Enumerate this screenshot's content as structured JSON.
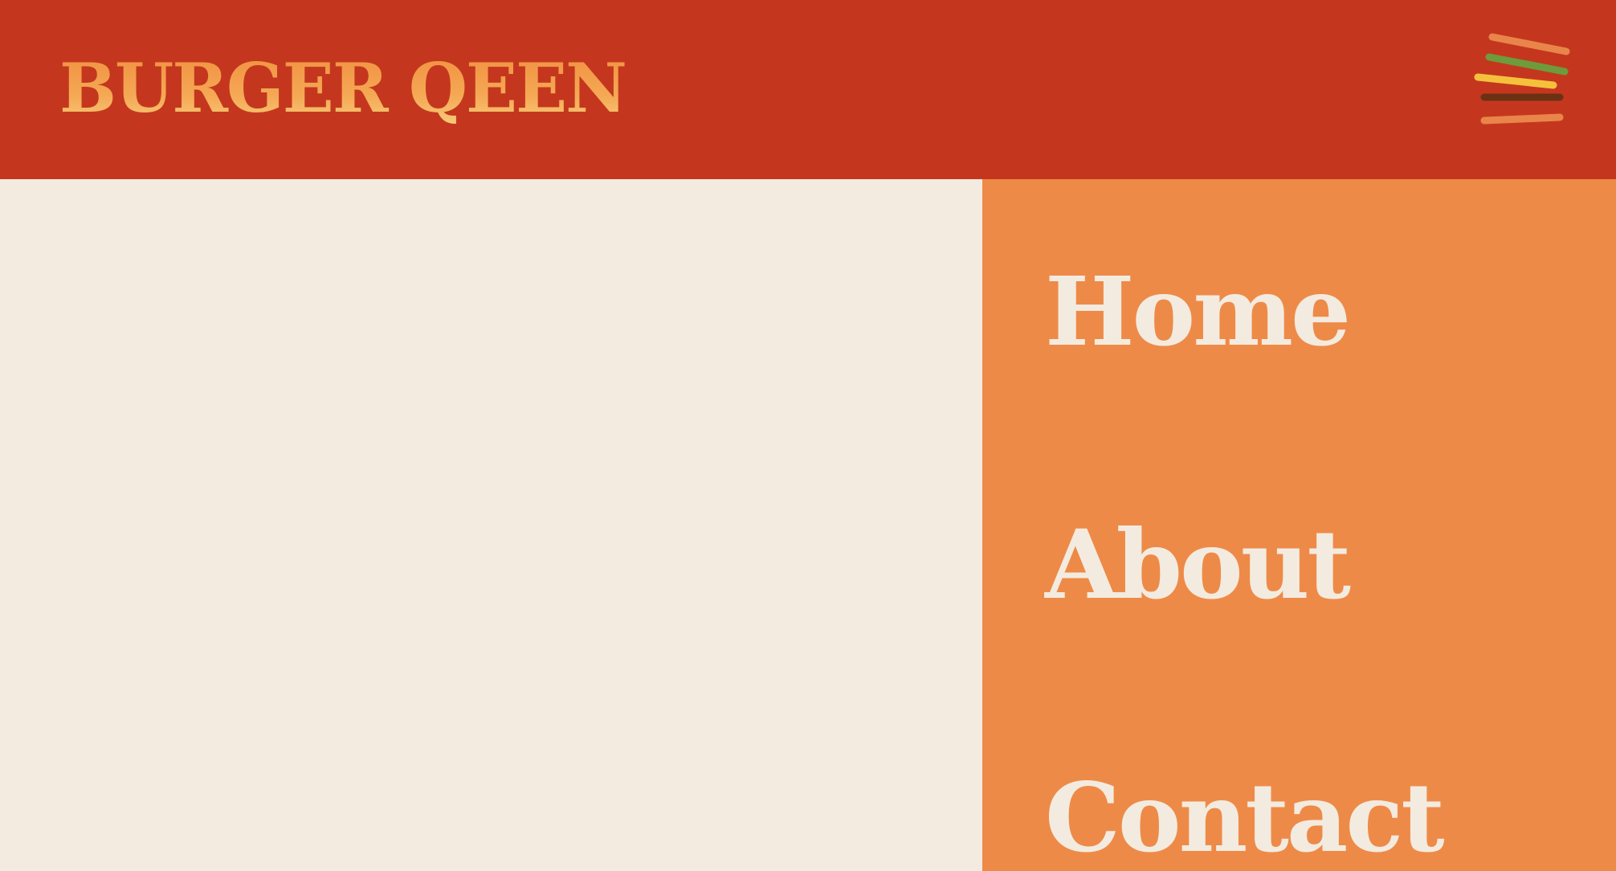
{
  "brand": {
    "logo_text": "BURGER QEEN"
  },
  "header": {
    "menu_icon": "hamburger-menu-icon",
    "menu_colors": [
      "#e9854a",
      "#6e9b3b",
      "#f5c13c",
      "#6b3113",
      "#e9854a"
    ]
  },
  "navigation": {
    "items": [
      {
        "label": "Home"
      },
      {
        "label": "About"
      },
      {
        "label": "Contact"
      }
    ]
  },
  "colors": {
    "header_bg": "#c4371e",
    "main_bg": "#f3ebdf",
    "nav_bg": "#ee8a48",
    "nav_text": "#f3ebdf",
    "logo_orange": "#f39a49"
  }
}
